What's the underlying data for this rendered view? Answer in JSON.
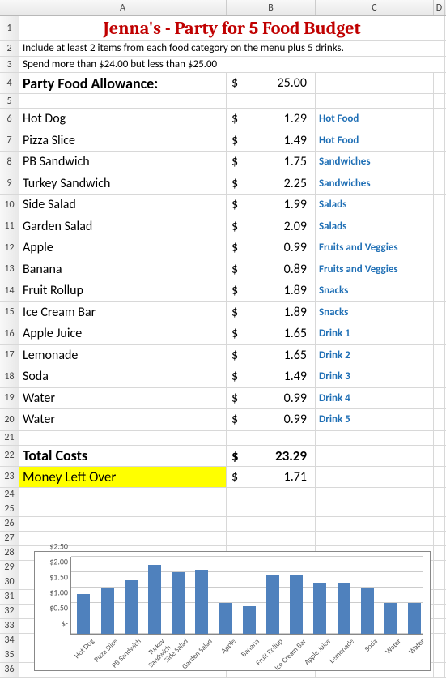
{
  "columns": [
    "A",
    "B",
    "C",
    "D"
  ],
  "title": "Jenna's  - Party for 5 Food Budget",
  "instructions": [
    "Include at least 2 items from each food category on the menu plus 5 drinks.",
    "Spend more than $24.00 but less than $25.00"
  ],
  "allowance_label": "Party Food Allowance:",
  "allowance_value": "25.00",
  "items": [
    {
      "name": "Hot Dog",
      "price": "1.29",
      "category": "Hot Food"
    },
    {
      "name": "Pizza Slice",
      "price": "1.49",
      "category": "Hot Food"
    },
    {
      "name": "PB Sandwich",
      "price": "1.75",
      "category": "Sandwiches"
    },
    {
      "name": "Turkey Sandwich",
      "price": "2.25",
      "category": "Sandwiches"
    },
    {
      "name": "Side Salad",
      "price": "1.99",
      "category": "Salads"
    },
    {
      "name": "Garden Salad",
      "price": "2.09",
      "category": "Salads"
    },
    {
      "name": "Apple",
      "price": "0.99",
      "category": "Fruits and Veggies"
    },
    {
      "name": "Banana",
      "price": "0.89",
      "category": "Fruits and Veggies"
    },
    {
      "name": "Fruit Rollup",
      "price": "1.89",
      "category": "Snacks"
    },
    {
      "name": "Ice Cream Bar",
      "price": "1.89",
      "category": "Snacks"
    },
    {
      "name": "Apple Juice",
      "price": "1.65",
      "category": "Drink 1"
    },
    {
      "name": "Lemonade",
      "price": "1.65",
      "category": "Drink 2"
    },
    {
      "name": "Soda",
      "price": "1.49",
      "category": "Drink 3"
    },
    {
      "name": "Water",
      "price": "0.99",
      "category": "Drink 4"
    },
    {
      "name": "Water",
      "price": "0.99",
      "category": "Drink 5"
    }
  ],
  "total_label": "Total Costs",
  "total_value": "23.29",
  "leftover_label": "Money Left Over",
  "leftover_value": "1.71",
  "chart_data": {
    "type": "bar",
    "categories": [
      "Hot Dog",
      "Pizza Slice",
      "PB Sandwich",
      "Turkey Sandwich",
      "Side Salad",
      "Garden Salad",
      "Apple",
      "Banana",
      "Fruit Rollup",
      "Ice Cream Bar",
      "Apple Juice",
      "Lemonade",
      "Soda",
      "Water",
      "Water"
    ],
    "values": [
      1.29,
      1.49,
      1.75,
      2.25,
      1.99,
      2.09,
      0.99,
      0.89,
      1.89,
      1.89,
      1.65,
      1.65,
      1.49,
      0.99,
      0.99
    ],
    "ylim": [
      0,
      2.5
    ],
    "yticks": [
      "$-",
      "$0.50",
      "$1.00",
      "$1.50",
      "$2.00",
      "$2.50"
    ],
    "title": "",
    "xlabel": "",
    "ylabel": ""
  },
  "dollar": "$"
}
